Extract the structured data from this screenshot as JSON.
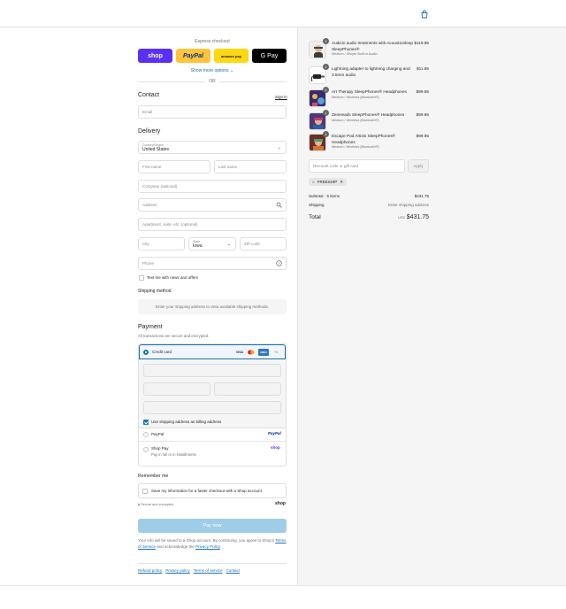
{
  "express": {
    "title": "Express checkout",
    "shop": "shop",
    "paypal": "PayPal",
    "amazon": "amazon pay",
    "gpay": "G Pay",
    "more_options": "Show more options ⌄",
    "or": "OR"
  },
  "contact": {
    "title": "Contact",
    "sign_in": "Sign in",
    "email_placeholder": "Email"
  },
  "delivery": {
    "title": "Delivery",
    "country_label": "Country/Region",
    "country_value": "United States",
    "first_name": "First name",
    "last_name": "Last name",
    "company": "Company (optional)",
    "address": "Address",
    "apartment": "Apartment, suite, etc. (optional)",
    "city": "City",
    "state_label": "State",
    "state_value": "Iowa",
    "zip": "ZIP code",
    "phone": "Phone",
    "text_offers": "Text me with news and offers"
  },
  "shipping_method": {
    "title": "Shipping method",
    "message": "Enter your shipping address to view available shipping methods."
  },
  "payment": {
    "title": "Payment",
    "subtitle": "All transactions are secure and encrypted.",
    "credit_card": "Credit card",
    "visa": "VISA",
    "amex": "AMEX",
    "more_cards": "+1",
    "billing_same": "Use shipping address as billing address",
    "paypal": "PayPal",
    "paypal_logo": "PayPal",
    "shop_pay": "Shop Pay",
    "shop_pay_sub": "Pay in full or in installments",
    "shop_logo": "shop"
  },
  "remember": {
    "title": "Remember me",
    "save_info": "Save my information for a faster checkout with a Shop account",
    "secure": "Secure and encrypted",
    "shop_logo": "shop"
  },
  "pay_now": "Pay now",
  "legal": {
    "text_before": "Your info will be saved to a Shop account. By continuing, you agree to Shop's ",
    "terms": "Terms of Service",
    "text_mid": " and acknowledge the ",
    "privacy": "Privacy Policy",
    "text_end": "."
  },
  "footer_links": [
    "Refund policy",
    "Privacy policy",
    "Terms of service",
    "Contact"
  ],
  "order": {
    "items": [
      {
        "qty": "1",
        "name": "Audicin audio treatments with AcousticSleep SleepPhones®",
        "variant": "Medium / Simple Built-in Audio",
        "price": "$119.95"
      },
      {
        "qty": "1",
        "name": "Lightning adapter to lightning charging and 3.5mm audio",
        "variant": "",
        "price": "$11.95"
      },
      {
        "qty": "1",
        "name": "Art Therapy SleepPhones® Headphones",
        "variant": "Medium / Wireless (Bluetooth®)",
        "price": "$99.95"
      },
      {
        "qty": "1",
        "name": "ZenHeads SleepPhones® Headphones",
        "variant": "Medium / Wireless (Bluetooth®)",
        "price": "$99.95"
      },
      {
        "qty": "1",
        "name": "Escape Pod Artists SleepPhones® Headphones",
        "variant": "Medium / Wireless (Bluetooth®)",
        "price": "$99.95"
      }
    ],
    "discount_placeholder": "Discount code or gift card",
    "apply": "Apply",
    "code": "FREESHIP",
    "subtotal_label": "Subtotal · 5 items",
    "subtotal_value": "$431.75",
    "shipping_label": "Shipping",
    "shipping_value": "Enter shipping address",
    "total_label": "Total",
    "currency": "USD",
    "total_value": "$431.75"
  },
  "colors": {
    "accent": "#1773b0",
    "shop_purple": "#5a31f4",
    "paypal_yellow": "#ffc439",
    "pay_now_disabled": "#9fcde7"
  }
}
